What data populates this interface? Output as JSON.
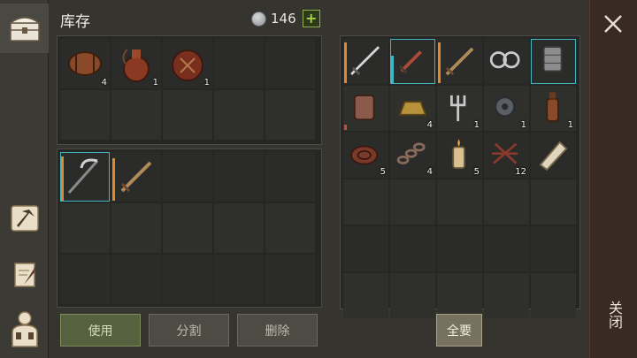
{
  "header": {
    "title": "库存",
    "currency_amount": "146",
    "plus_label": "+"
  },
  "buttons": {
    "use": "使用",
    "split": "分割",
    "delete": "删除",
    "take_all": "全要"
  },
  "close": {
    "label": "关闭"
  },
  "tabs": [
    {
      "name": "inventory-chest-icon",
      "active": true
    },
    {
      "name": "crafting-hammer-icon",
      "active": false
    },
    {
      "name": "scroll-quill-icon",
      "active": false
    },
    {
      "name": "character-equipment-icon",
      "active": false
    }
  ],
  "backpack_top": [
    {
      "item": "barrel",
      "count": "4"
    },
    {
      "item": "gourd-flask",
      "count": "1"
    },
    {
      "item": "leather-water-bag",
      "count": "1"
    }
  ],
  "backpack_bottom": [
    {
      "item": "scythe",
      "count": ""
    },
    {
      "item": "wooden-sword",
      "count": ""
    }
  ],
  "container": [
    {
      "item": "iron-sword",
      "count": ""
    },
    {
      "item": "red-dagger",
      "count": ""
    },
    {
      "item": "wooden-sword",
      "count": ""
    },
    {
      "item": "iron-shackles",
      "count": ""
    },
    {
      "item": "armor-gauntlet",
      "count": ""
    },
    {
      "item": "leather-armor",
      "count": ""
    },
    {
      "item": "gold-ingot",
      "count": "4"
    },
    {
      "item": "pitchfork-head",
      "count": "1"
    },
    {
      "item": "gear-parts",
      "count": "1"
    },
    {
      "item": "bottle",
      "count": "1"
    },
    {
      "item": "leather-roll",
      "count": "5"
    },
    {
      "item": "chain",
      "count": "4"
    },
    {
      "item": "candle",
      "count": "5"
    },
    {
      "item": "twine-bundle",
      "count": "12"
    },
    {
      "item": "cloth-scroll",
      "count": ""
    }
  ],
  "colors": {
    "selection": "#3fb7c2",
    "plus_green": "#a9d14a",
    "durability_orange": "#e08a2c",
    "durability_red": "#d44a3c"
  }
}
